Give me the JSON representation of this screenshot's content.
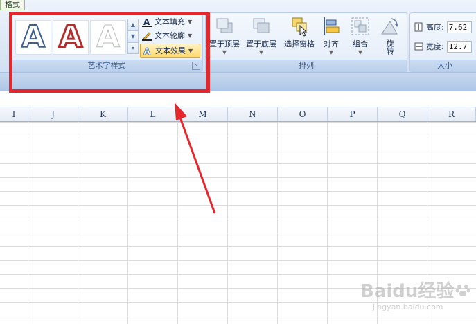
{
  "ribbon": {
    "context_tab": "格式",
    "wordart_styles": {
      "label": "艺术字样式",
      "commands": [
        {
          "label": "文本填充",
          "icon": "text-fill-icon"
        },
        {
          "label": "文本轮廓",
          "icon": "text-outline-icon"
        },
        {
          "label": "文本效果",
          "icon": "text-effects-icon"
        }
      ],
      "gallery": [
        "A",
        "A",
        "A"
      ]
    },
    "arrange": {
      "label": "排列",
      "buttons": [
        {
          "label": "置于顶层",
          "icon": "bring-to-front-icon"
        },
        {
          "label": "置于底层",
          "icon": "send-to-back-icon"
        },
        {
          "label": "选择窗格",
          "icon": "selection-pane-icon"
        },
        {
          "label": "对齐",
          "icon": "align-icon"
        },
        {
          "label": "组合",
          "icon": "group-icon"
        },
        {
          "label": "旋转",
          "icon": "rotate-icon"
        }
      ]
    },
    "size": {
      "label": "大小",
      "height_label": "高度:",
      "height_value": "7.62",
      "width_label": "宽度:",
      "width_value": "12.7"
    }
  },
  "sheet": {
    "columns": [
      "I",
      "J",
      "K",
      "L",
      "M",
      "N",
      "O",
      "P",
      "Q",
      "R"
    ]
  },
  "colors": {
    "highlight": "#e5262b",
    "accent": "#ffd966"
  },
  "watermark": {
    "brand": "Baidu经验",
    "url": "jingyan.baidu.com"
  }
}
